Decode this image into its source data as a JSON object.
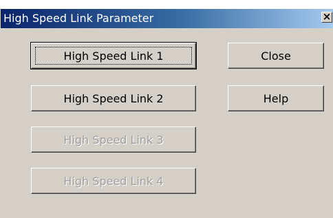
{
  "window": {
    "title": "High Speed Link Parameter",
    "close_glyph": "×"
  },
  "buttons": {
    "link1": "High Speed Link 1",
    "link2": "High Speed Link 2",
    "link3": "High Speed Link 3",
    "link4": "High Speed Link 4",
    "close": "Close",
    "help": "Help"
  },
  "state": {
    "focused": "High Speed Link 1",
    "disabled": [
      "High Speed Link 3",
      "High Speed Link 4"
    ]
  },
  "colors": {
    "titlebar_start": "#0a246a",
    "titlebar_end": "#a6caf0",
    "face": "#d4d0c8",
    "disabled_text": "#a0a0a0"
  }
}
